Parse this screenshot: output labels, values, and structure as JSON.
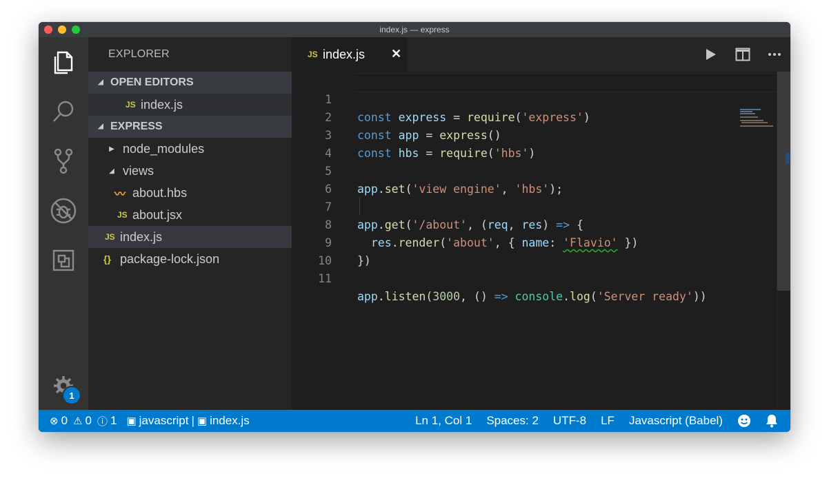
{
  "window": {
    "title": "index.js — express"
  },
  "activity_bar": {
    "items": [
      {
        "icon": "files-icon",
        "active": true
      },
      {
        "icon": "search-icon",
        "active": false
      },
      {
        "icon": "source-control-icon",
        "active": false
      },
      {
        "icon": "debug-icon",
        "active": false
      },
      {
        "icon": "extensions-icon",
        "active": false
      }
    ],
    "settings_icon": "gear-icon",
    "settings_badge": "1"
  },
  "sidebar": {
    "title": "EXPLORER",
    "open_editors": {
      "label": "OPEN EDITORS",
      "files": [
        {
          "icon": "JS",
          "name": "index.js"
        }
      ]
    },
    "project": {
      "label": "EXPRESS",
      "tree": [
        {
          "name": "node_modules",
          "type": "folder",
          "expanded": false
        },
        {
          "name": "views",
          "type": "folder",
          "expanded": true
        },
        {
          "name": "about.hbs",
          "type": "file",
          "icon": "hbs"
        },
        {
          "name": "about.jsx",
          "type": "file",
          "icon": "JS"
        },
        {
          "name": "index.js",
          "type": "file",
          "icon": "JS",
          "selected": true
        },
        {
          "name": "package-lock.json",
          "type": "file",
          "icon": "{}"
        }
      ]
    }
  },
  "editor": {
    "active_tab": {
      "icon": "JS",
      "label": "index.js",
      "close": "✕"
    },
    "actions": [
      "run-icon",
      "split-editor-icon",
      "more-icon"
    ],
    "lines": [
      {
        "n": "1"
      },
      {
        "n": "2"
      },
      {
        "n": "3"
      },
      {
        "n": "4"
      },
      {
        "n": "5"
      },
      {
        "n": "6"
      },
      {
        "n": "7"
      },
      {
        "n": "8"
      },
      {
        "n": "9"
      },
      {
        "n": "10"
      },
      {
        "n": "11"
      }
    ],
    "tokens": {
      "const": "const",
      "express": "express",
      "eq": " = ",
      "require": "require",
      "str_express": "'express'",
      "app": "app",
      "express_call": "express",
      "hbs": "hbs",
      "str_hbs": "'hbs'",
      "set": "set",
      "str_view_engine": "'view engine'",
      "get": "get",
      "str_about_path": "'/about'",
      "req": "req",
      "res": "res",
      "arrow": "=>",
      "render": "render",
      "str_about": "'about'",
      "name": "name",
      "str_flavio": "'Flavio'",
      "listen": "listen",
      "port": "3000",
      "console": "console",
      "log": "log",
      "str_server_ready": "'Server ready'"
    }
  },
  "status_bar": {
    "errors": "0",
    "warnings": "0",
    "info": "1",
    "language_context": "javascript",
    "file_context": "index.js",
    "cursor": "Ln 1, Col 1",
    "spaces": "Spaces: 2",
    "encoding": "UTF-8",
    "eol": "LF",
    "language_mode": "Javascript (Babel)",
    "feedback_icon": "smiley-icon",
    "notifications_icon": "bell-icon"
  },
  "colors": {
    "accent": "#007acc",
    "keyword": "#569cd6",
    "string": "#ce9178",
    "function": "#dcdcaa",
    "variable": "#9cdcfe"
  }
}
